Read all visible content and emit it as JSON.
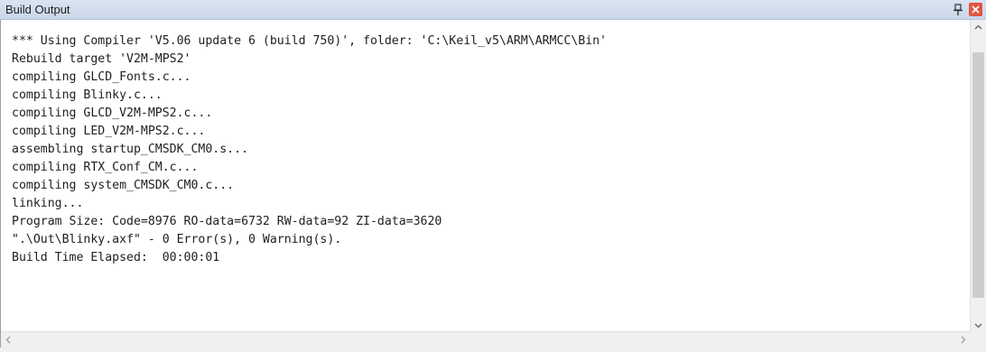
{
  "window": {
    "title": "Build Output"
  },
  "build_output": {
    "lines": [
      "*** Using Compiler 'V5.06 update 6 (build 750)', folder: 'C:\\Keil_v5\\ARM\\ARMCC\\Bin'",
      "Rebuild target 'V2M-MPS2'",
      "compiling GLCD_Fonts.c...",
      "compiling Blinky.c...",
      "compiling GLCD_V2M-MPS2.c...",
      "compiling LED_V2M-MPS2.c...",
      "assembling startup_CMSDK_CM0.s...",
      "compiling RTX_Conf_CM.c...",
      "compiling system_CMSDK_CM0.c...",
      "linking...",
      "Program Size: Code=8976 RO-data=6732 RW-data=92 ZI-data=3620",
      "\".\\Out\\Blinky.axf\" - 0 Error(s), 0 Warning(s).",
      "Build Time Elapsed:  00:00:01"
    ]
  },
  "icons": {
    "pin": "pin-icon",
    "close": "close-icon",
    "scroll_up": "chevron-up-icon",
    "scroll_down": "chevron-down-icon",
    "scroll_left": "chevron-left-icon",
    "scroll_right": "chevron-right-icon"
  },
  "colors": {
    "title_bar": "#cad7ea",
    "close_button": "#e0573f",
    "text": "#202020",
    "background": "#ffffff"
  }
}
